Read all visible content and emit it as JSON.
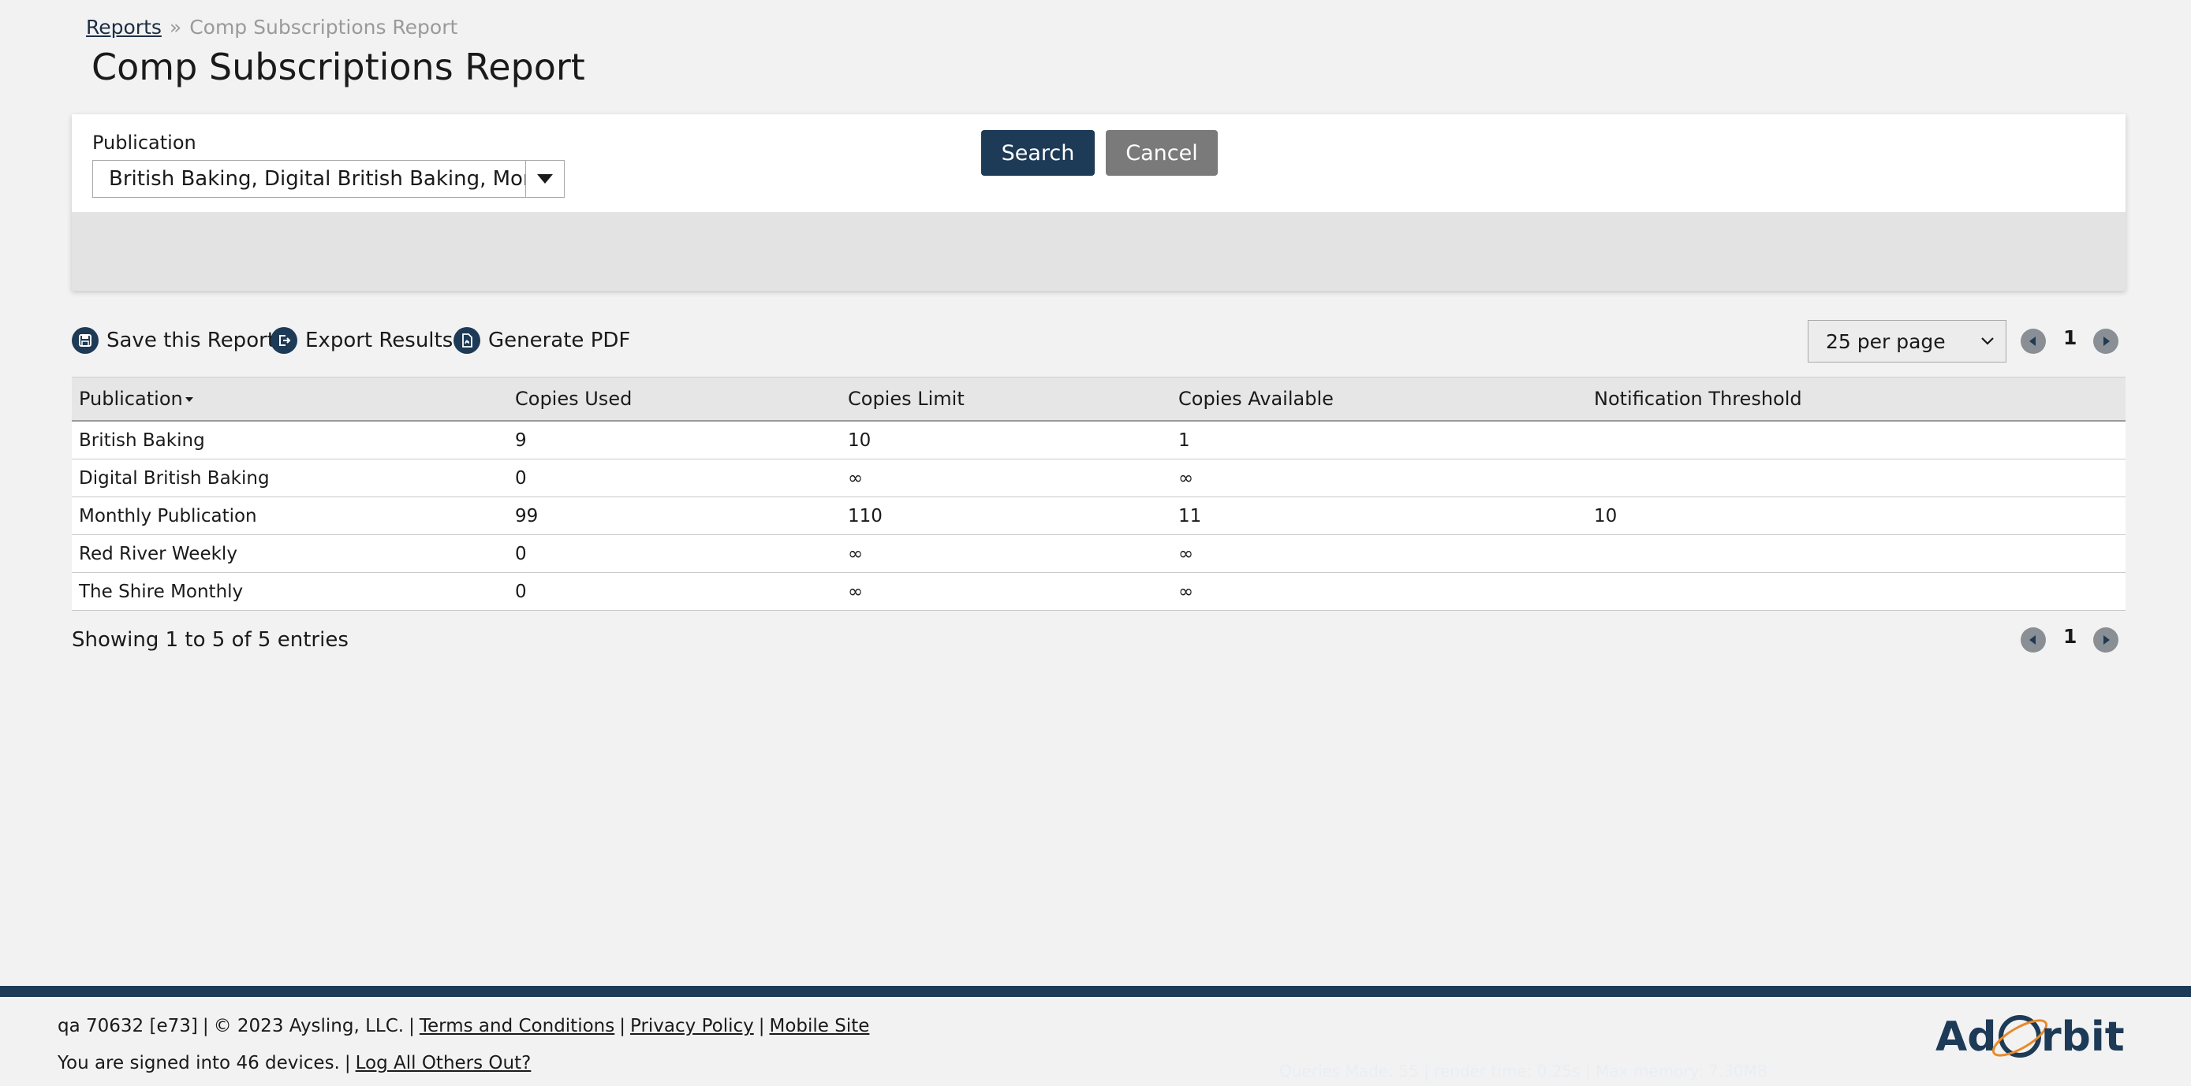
{
  "breadcrumb": {
    "root": "Reports",
    "separator": "»",
    "current": "Comp Subscriptions Report"
  },
  "page_title": "Comp Subscriptions Report",
  "filter": {
    "publication_label": "Publication",
    "publication_value": "British Baking, Digital British Baking, Mont...",
    "search_label": "Search",
    "cancel_label": "Cancel"
  },
  "toolbar": {
    "save_label": "Save this Report",
    "export_label": "Export Results",
    "pdf_label": "Generate PDF",
    "per_page": "25 per page",
    "page": "1"
  },
  "table": {
    "headers": [
      "Publication",
      "Copies Used",
      "Copies Limit",
      "Copies Available",
      "Notification Threshold"
    ],
    "rows": [
      [
        "British Baking",
        "9",
        "10",
        "1",
        ""
      ],
      [
        "Digital British Baking",
        "0",
        "∞",
        "∞",
        ""
      ],
      [
        "Monthly Publication",
        "99",
        "110",
        "11",
        "10"
      ],
      [
        "Red River Weekly",
        "0",
        "∞",
        "∞",
        ""
      ],
      [
        "The Shire Monthly",
        "0",
        "∞",
        "∞",
        ""
      ]
    ]
  },
  "summary": {
    "showing": "Showing 1 to 5 of 5 entries",
    "page": "1"
  },
  "footer": {
    "build": "qa 70632 [e73]",
    "copyright": "© 2023 Aysling, LLC.",
    "terms": "Terms and Conditions",
    "privacy": "Privacy Policy",
    "mobile": "Mobile Site",
    "signed_in": "You are signed into 46 devices.",
    "log_out_others": "Log All Others Out?",
    "debug": "Queries Made: 55 | render time: 0.25s | Max memory: 7.30MB",
    "logo_text_left": "Ad",
    "logo_text_right": "rbit"
  },
  "colors": {
    "primary": "#1d3a56",
    "cancel": "#7a7a7a",
    "pager": "#8a8f95",
    "logo_orange": "#e88a2a"
  }
}
